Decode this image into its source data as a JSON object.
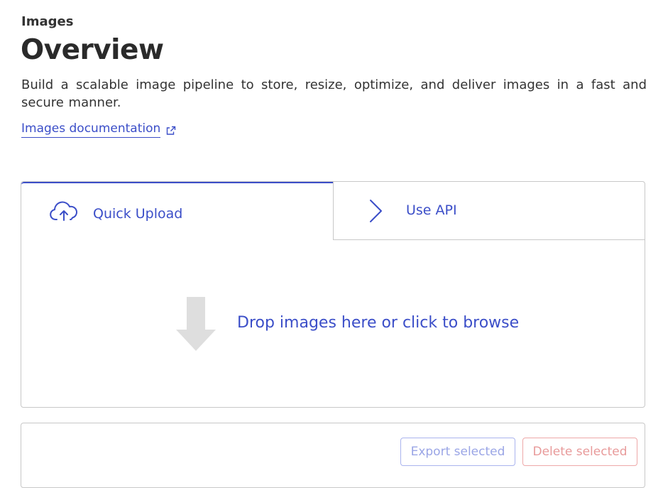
{
  "header": {
    "section_label": "Images",
    "title": "Overview",
    "description": "Build a scalable image pipeline to store, resize, optimize, and deliver images in a fast and secure manner.",
    "doc_link_label": "Images documentation",
    "doc_link_icon": "external-link-icon"
  },
  "upload": {
    "tabs": [
      {
        "label": "Quick Upload",
        "icon": "cloud-upload-icon",
        "active": true
      },
      {
        "label": "Use API",
        "icon": "chevron-right-icon",
        "active": false
      }
    ],
    "dropzone_text": "Drop images here or click to browse",
    "dropzone_icon": "down-arrow-icon"
  },
  "actions": {
    "export_label": "Export selected",
    "delete_label": "Delete selected",
    "export_enabled": false,
    "delete_enabled": false
  },
  "colors": {
    "accent": "#3b4ec8",
    "border": "#c8c8c8",
    "danger_disabled": "#e89a9a",
    "accent_disabled": "#9aa5e6"
  }
}
